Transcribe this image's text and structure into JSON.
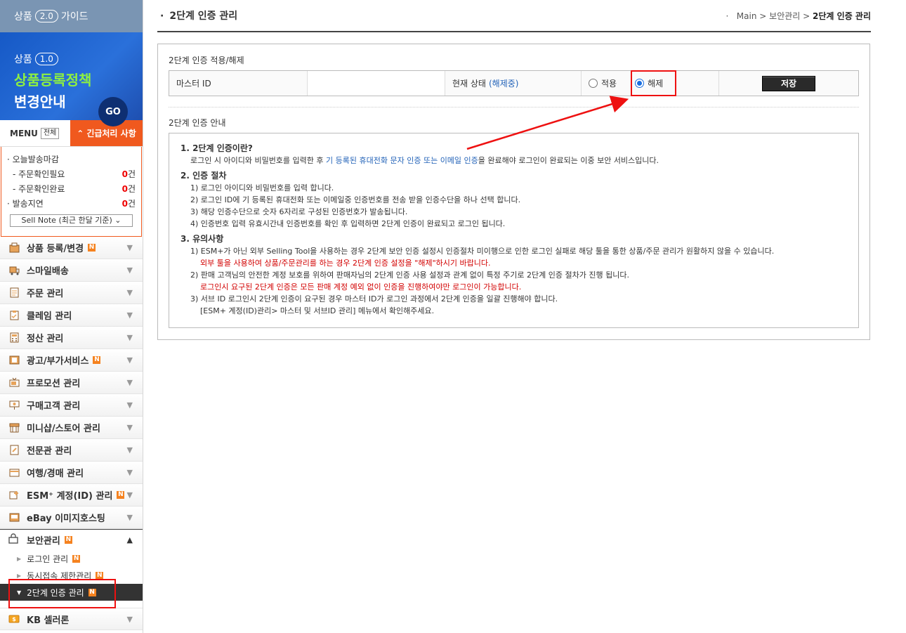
{
  "sidebar": {
    "guide": {
      "prefix": "상품",
      "version": "2.0",
      "suffix": "가이드"
    },
    "banner": {
      "prefix": "상품",
      "version": "1.0",
      "line2": "상품등록정책",
      "line3": "변경안내",
      "go": "GO"
    },
    "menu_label": "MENU",
    "menu_all": "전체",
    "urgent_label": "긴급처리 사항",
    "urgent": {
      "today": "· 오늘발송마감",
      "items": [
        {
          "label": "- 주문확인필요",
          "count": "0",
          "unit": "건"
        },
        {
          "label": "- 주문확인완료",
          "count": "0",
          "unit": "건"
        }
      ],
      "delay": {
        "label": "· 발송지연",
        "count": "0",
        "unit": "건"
      },
      "sellnote": "Sell Note (최근 한달 기준) ⌄"
    },
    "nav": [
      {
        "label": "상품 등록/변경",
        "icon": "product-icon",
        "new": true
      },
      {
        "label": "스마일배송",
        "icon": "truck-icon",
        "new": false
      },
      {
        "label": "주문 관리",
        "icon": "order-icon",
        "new": false
      },
      {
        "label": "클레임 관리",
        "icon": "claim-icon",
        "new": false
      },
      {
        "label": "정산 관리",
        "icon": "calculator-icon",
        "new": false
      },
      {
        "label": "광고/부가서비스",
        "icon": "film-icon",
        "new": true
      },
      {
        "label": "프로모션 관리",
        "icon": "tv-icon",
        "new": false
      },
      {
        "label": "구매고객 관리",
        "icon": "presentation-icon",
        "new": false
      },
      {
        "label": "미니샵/스토어 관리",
        "icon": "store-icon",
        "new": false
      },
      {
        "label": "전문관 관리",
        "icon": "document-icon",
        "new": false
      },
      {
        "label": "여행/경매 관리",
        "icon": "card-icon",
        "new": false
      },
      {
        "label": "ESM⁺ 계정(ID) 관리",
        "icon": "account-icon",
        "new": true
      },
      {
        "label": "eBay 이미지호스팅",
        "icon": "image-icon",
        "new": false
      }
    ],
    "security": {
      "label": "보안관리",
      "subs": [
        {
          "label": "로그인 관리"
        },
        {
          "label": "동시접속 제한관리"
        },
        {
          "label": "2단계 인증 관리"
        }
      ]
    },
    "kb": {
      "label": "KB 셀러론"
    }
  },
  "main": {
    "title": "2단계 인증 관리",
    "breadcrumb": {
      "a": "Main",
      "b": "보안관리",
      "c": "2단계 인증 관리",
      "sep": ">"
    },
    "apply_section": "2단계 인증 적용/해제",
    "master_id_label": "마스터 ID",
    "current_status_label": "현재 상태",
    "current_status_value": "(해제중)",
    "radio_apply": "적용",
    "radio_release": "해제",
    "save": "저장",
    "guide_section": "2단계 인증 안내",
    "guide": {
      "h1": "1. 2단계 인증이란?",
      "p1a": "로그인 시 아이디와 비밀번호를 입력한 후 ",
      "p1b": "기 등록된 휴대전화 문자 인증 또는 이메일 인증",
      "p1c": "을 완료해야 로그인이 완료되는 이중 보안 서비스입니다.",
      "h2": "2. 인증 절차",
      "s1": "1) 로그인 아이디와 비밀번호를 입력 합니다.",
      "s2": "2) 로그인 ID에 기 등록된 휴대전화 또는 이메일중 인증번호를 전송 받을 인증수단을 하나 선택 합니다.",
      "s3": "3) 해당 인증수단으로 숫자 6자리로 구성된 인증번호가 발송됩니다.",
      "s4": "4) 인증번호 입력 유효시간내 인증번호를 확인 후 입력하면 2단계 인증이 완료되고 로그인 됩니다.",
      "h3": "3. 유의사항",
      "n1": "1) ESM+가 아닌 외부 Selling Tool을 사용하는 경우 2단계 보안 인증 설정시 인증절차 미이행으로 인한 로그인 실패로 해당 툴을 통한 상품/주문 관리가 원활하지 않을 수 있습니다.",
      "n1r": "외부 툴을 사용하여 상품/주문관리를 하는 경우 2단계 인증 설정을 \"해제\"하시기 바랍니다.",
      "n2": "2) 판매 고객님의 안전한 계정 보호를 위하여 판매자님의 2단계 인증 사용 설정과 관계 없이 특정 주기로 2단계 인증 절차가 진행 됩니다.",
      "n2r": "로그인시 요구된 2단계 인증은 모든 판매 계정 예외 없이 인증을 진행하여야만 로그인이 가능합니다.",
      "n3": "3) 서브 ID 로그인시 2단계 인증이 요구된 경우 마스터 ID가 로그인 과정에서 2단계 인증을 일괄 진행해야 합니다.",
      "n3b": "[ESM+ 계정(ID)관리> 마스터 및 서브ID 관리] 메뉴에서 확인해주세요."
    }
  },
  "colors": {
    "accent": "#f0591e",
    "highlight_red": "#e11111",
    "link_blue": "#2363b8"
  }
}
